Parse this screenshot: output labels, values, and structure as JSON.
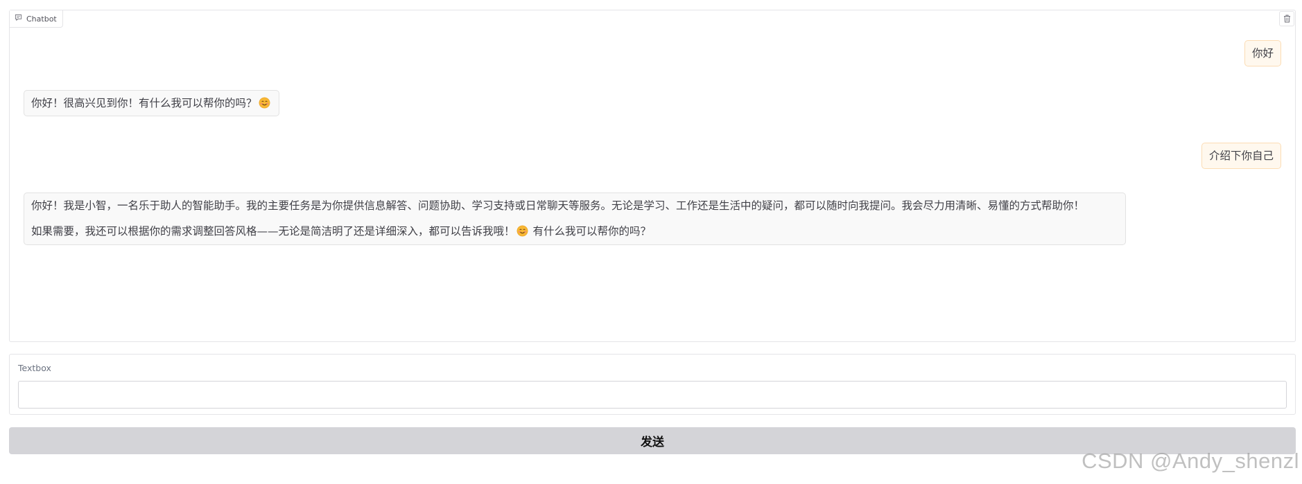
{
  "chatbot": {
    "label": "Chatbot",
    "label_icon": "chat-bubble-icon",
    "clear_icon": "trash-icon",
    "messages": [
      {
        "role": "user",
        "text": "你好"
      },
      {
        "role": "bot",
        "text": "你好！很高兴见到你！有什么我可以帮你的吗？",
        "emoji": "smiling-face-icon"
      },
      {
        "role": "user",
        "text": "介绍下你自己"
      },
      {
        "role": "bot",
        "paragraph1": "你好！我是小智，一名乐于助人的智能助手。我的主要任务是为你提供信息解答、问题协助、学习支持或日常聊天等服务。无论是学习、工作还是生活中的疑问，都可以随时向我提问。我会尽力用清晰、易懂的方式帮助你！",
        "paragraph2_before_emoji": "如果需要，我还可以根据你的需求调整回答风格——无论是简洁明了还是详细深入，都可以告诉我哦！",
        "paragraph2_after_emoji": "有什么我可以帮你的吗？",
        "emoji": "smiling-face-icon"
      }
    ]
  },
  "textbox": {
    "label": "Textbox",
    "value": "",
    "placeholder": ""
  },
  "send_button": {
    "label": "发送"
  },
  "watermark": "CSDN @Andy_shenzl",
  "colors": {
    "user_bubble_bg": "#fff8ee",
    "user_bubble_border": "#fcdcb4",
    "bot_bubble_bg": "#f9f9f9",
    "button_bg": "#d4d4d8"
  }
}
